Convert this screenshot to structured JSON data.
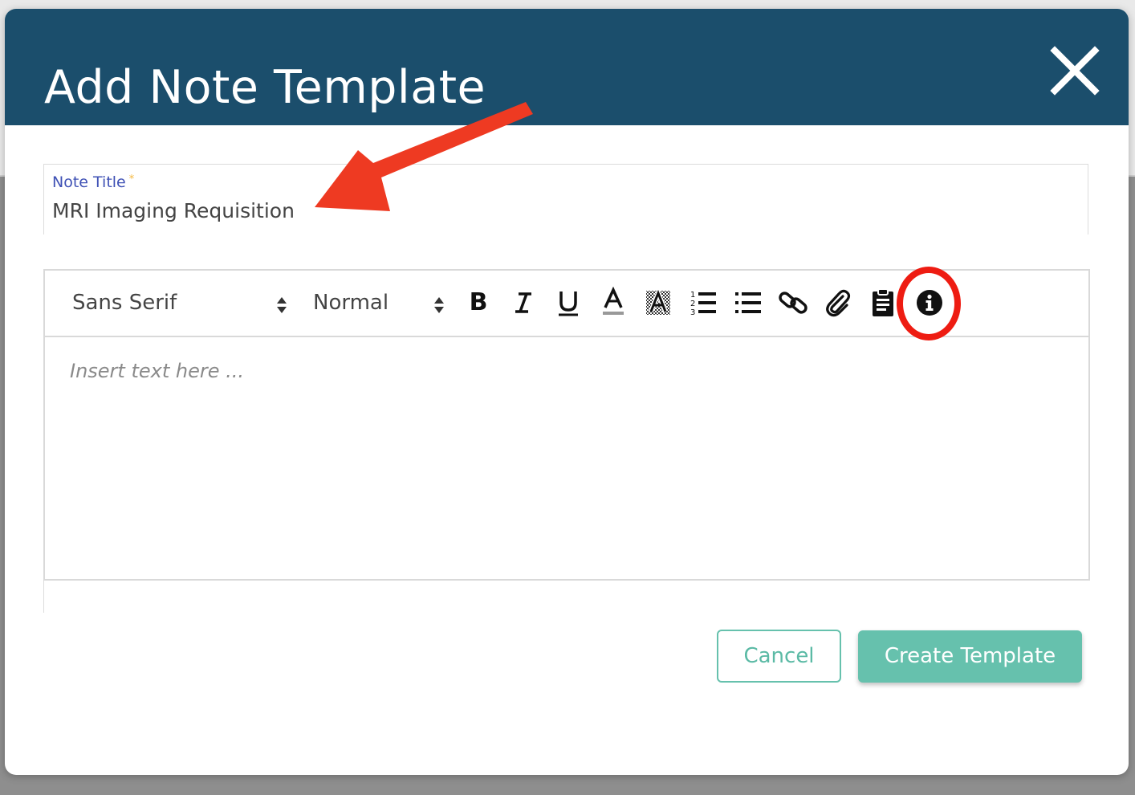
{
  "modal": {
    "title": "Add Note Template"
  },
  "note_title_field": {
    "label": "Note Title",
    "required_marker": "*",
    "value": "MRI Imaging Requisition"
  },
  "toolbar": {
    "font_select": "Sans Serif",
    "size_select": "Normal",
    "buttons": [
      {
        "name": "bold",
        "label": "B"
      },
      {
        "name": "italic",
        "label": "I"
      },
      {
        "name": "underline",
        "label": "U"
      },
      {
        "name": "text-color",
        "label": "A"
      },
      {
        "name": "background-color",
        "label": "A"
      },
      {
        "name": "ordered-list",
        "icon": "ordered-list-icon"
      },
      {
        "name": "bullet-list",
        "icon": "bullet-list-icon"
      },
      {
        "name": "link",
        "icon": "link-icon"
      },
      {
        "name": "attachment",
        "icon": "paperclip-icon"
      },
      {
        "name": "clipboard",
        "icon": "clipboard-icon"
      },
      {
        "name": "info",
        "icon": "info-icon"
      }
    ]
  },
  "editor": {
    "placeholder": "Insert text here ..."
  },
  "actions": {
    "cancel_label": "Cancel",
    "create_label": "Create Template"
  },
  "colors": {
    "header": "#1b4e6c",
    "accent": "#66c1ad",
    "label": "#3f51b5",
    "annotation": "#ee1c12"
  }
}
